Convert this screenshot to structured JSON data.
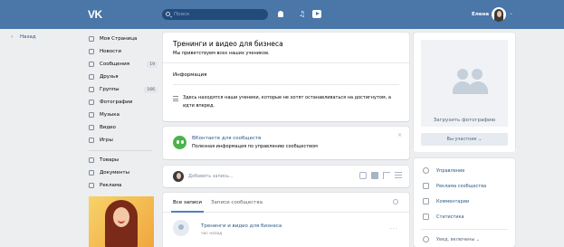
{
  "header": {
    "logo": "VK",
    "search_placeholder": "Поиск",
    "user_name": "Елена"
  },
  "back_label": "Назад",
  "nav": {
    "items": [
      {
        "label": "Моя Страница",
        "icon": "home-icon"
      },
      {
        "label": "Новости",
        "icon": "news-icon"
      },
      {
        "label": "Сообщения",
        "icon": "messages-icon",
        "badge": "19"
      },
      {
        "label": "Друзья",
        "icon": "friends-icon"
      },
      {
        "label": "Группы",
        "icon": "groups-icon",
        "badge": "166"
      },
      {
        "label": "Фотографии",
        "icon": "photos-icon"
      },
      {
        "label": "Музыка",
        "icon": "music-icon"
      },
      {
        "label": "Видео",
        "icon": "video-icon"
      },
      {
        "label": "Игры",
        "icon": "games-icon"
      }
    ],
    "extra": [
      {
        "label": "Товары",
        "icon": "goods-icon"
      },
      {
        "label": "Документы",
        "icon": "documents-icon"
      },
      {
        "label": "Реклама",
        "icon": "ads-icon"
      }
    ]
  },
  "group": {
    "title": "Тренинги и видео для бизнеса",
    "subtitle": "Мы приветствуем всех наших учеников.",
    "info_heading": "Информация",
    "info_text": "Здесь находятся наши ученики, которые не хотят останавливаться на достигнутом, а идти вперед."
  },
  "promo": {
    "title": "ВКонтакте для сообществ",
    "description": "Полезная информация по управлению сообществом",
    "close": "×"
  },
  "composer": {
    "placeholder": "Добавить запись..."
  },
  "wall": {
    "tab_all": "Все записи",
    "tab_community": "Записи сообщества",
    "post_title": "Тренинги и видео для бизнеса",
    "post_time": "час назад",
    "post_menu": "···"
  },
  "sidebar": {
    "upload_photo": "Загрузить фотографию",
    "member_button": "Вы участник ⌄",
    "items": [
      {
        "label": "Управление",
        "icon": "gear-icon"
      },
      {
        "label": "Реклама сообщества",
        "icon": "megaphone-icon"
      },
      {
        "label": "Комментарии",
        "icon": "comment-icon"
      },
      {
        "label": "Статистика",
        "icon": "stats-icon"
      }
    ],
    "notifications": "Увед. включены ⌄"
  }
}
